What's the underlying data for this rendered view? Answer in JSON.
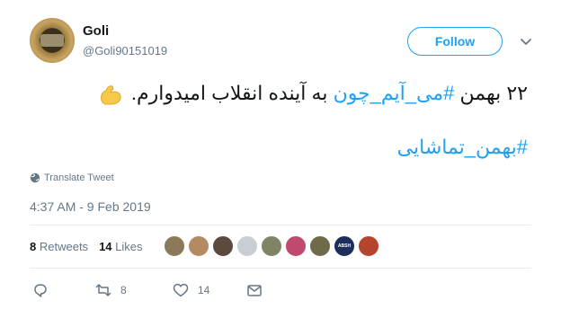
{
  "user": {
    "display_name": "Goli",
    "handle": "@Goli90151019",
    "follow_label": "Follow"
  },
  "tweet": {
    "line1_text_a": "۲۲ بهمن ",
    "line1_hashtag": "#می_آیم_چون",
    "line1_text_b": " به آینده انقلاب امیدوارم.",
    "line2_hashtag": "#بهمن_تماشایی",
    "translate_label": "Translate Tweet",
    "timestamp": "4:37 AM - 9 Feb 2019"
  },
  "stats": {
    "retweets_count": "8",
    "retweets_label": "Retweets",
    "likes_count": "14",
    "likes_label": "Likes"
  },
  "likers": [
    {
      "color": "#8a7a5a"
    },
    {
      "color": "#b48a62"
    },
    {
      "color": "#5d4a3e"
    },
    {
      "color": "#c8ced3"
    },
    {
      "color": "#7f8466"
    },
    {
      "color": "#c04a6d"
    },
    {
      "color": "#6f6b4a"
    },
    {
      "color": "#1c2f5a",
      "label": "ABSH"
    },
    {
      "color": "#b4442c"
    }
  ],
  "actions": {
    "reply_count": "",
    "retweet_count": "8",
    "like_count": "14"
  },
  "colors": {
    "accent": "#1da1f2",
    "muted": "#657786",
    "text": "#14171a"
  },
  "icons": [
    "caret-down-icon",
    "muscle-emoji-icon",
    "globe-icon",
    "reply-icon",
    "retweet-icon",
    "heart-icon",
    "message-icon"
  ]
}
